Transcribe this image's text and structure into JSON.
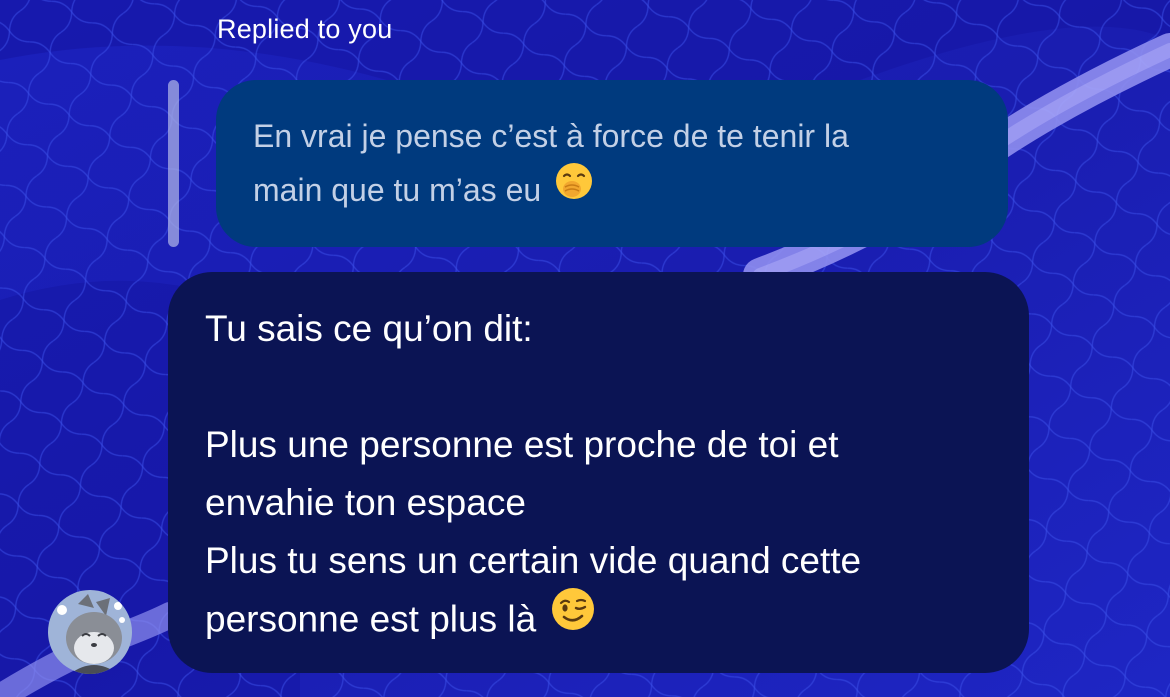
{
  "reply": {
    "label": "Replied to you",
    "quoted_text_line1": "En vrai je pense c’est à force de te tenir la",
    "quoted_text_line2": "main que tu m’as eu",
    "quoted_emoji": "face-with-hand-over-mouth-icon"
  },
  "message": {
    "line1": "Tu sais ce qu’on dit:",
    "line2": "Plus une personne est proche de toi et",
    "line3": "envahie ton espace",
    "line4": "Plus tu sens un certain vide quand cette",
    "line5": "personne est plus là",
    "emoji": "winking-face-icon"
  },
  "colors": {
    "background": "#1a1fb8",
    "quoted_bubble": "#003a7e",
    "message_bubble": "#0b1454",
    "reply_bar": "#aab0e6"
  },
  "avatar": {
    "icon": "sender-avatar"
  }
}
